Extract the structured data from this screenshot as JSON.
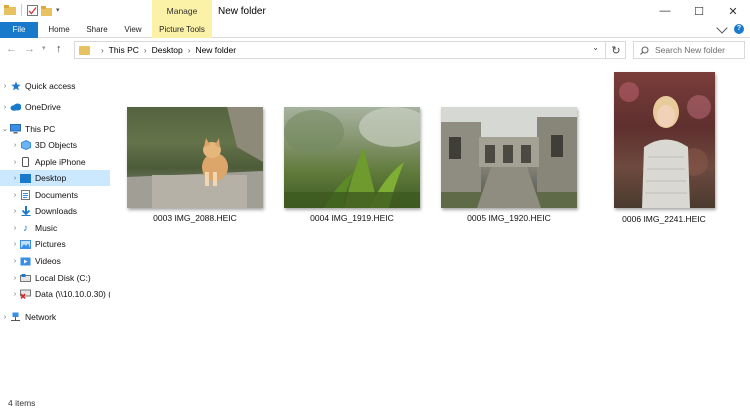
{
  "window": {
    "title": "New folder",
    "manage_label": "Manage",
    "minimize": "—",
    "maximize": "☐",
    "close": "✕"
  },
  "ribbon": {
    "tabs": [
      {
        "label": "File"
      },
      {
        "label": "Home"
      },
      {
        "label": "Share"
      },
      {
        "label": "View"
      },
      {
        "label": "Picture Tools"
      }
    ]
  },
  "address": {
    "crumbs": [
      "This PC",
      "Desktop",
      "New folder"
    ],
    "search_placeholder": "Search New folder"
  },
  "sidebar": {
    "items": [
      {
        "label": "Quick access",
        "icon": "star-icon"
      },
      {
        "label": "OneDrive",
        "icon": "cloud-icon"
      },
      {
        "label": "This PC",
        "icon": "computer-icon"
      },
      {
        "label": "3D Objects",
        "icon": "cube-icon"
      },
      {
        "label": "Apple iPhone",
        "icon": "phone-icon"
      },
      {
        "label": "Desktop",
        "icon": "desktop-icon"
      },
      {
        "label": "Documents",
        "icon": "document-icon"
      },
      {
        "label": "Downloads",
        "icon": "download-icon"
      },
      {
        "label": "Music",
        "icon": "music-icon"
      },
      {
        "label": "Pictures",
        "icon": "picture-icon"
      },
      {
        "label": "Videos",
        "icon": "video-icon"
      },
      {
        "label": "Local Disk (C:)",
        "icon": "drive-icon"
      },
      {
        "label": "Data (\\\\10.10.0.30) (",
        "icon": "network-drive-icon"
      },
      {
        "label": "Network",
        "icon": "network-icon"
      }
    ]
  },
  "files": [
    {
      "name": "0003 IMG_2088.HEIC"
    },
    {
      "name": "0004 IMG_1919.HEIC"
    },
    {
      "name": "0005 IMG_1920.HEIC"
    },
    {
      "name": "0006 IMG_2241.HEIC"
    }
  ],
  "status": {
    "count": "4 items"
  },
  "colors": {
    "accent": "#1979ca",
    "selection": "#cce8ff",
    "picture_tools": "#fbf2a8"
  }
}
